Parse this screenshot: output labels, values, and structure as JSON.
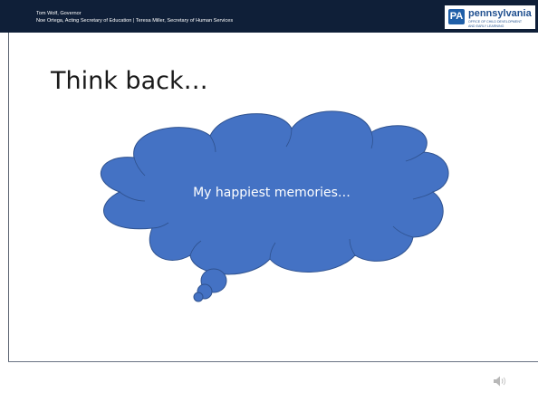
{
  "header": {
    "governor_line": "Tom Wolf, Governor",
    "secretaries_line": "Noe Ortega, Acting Secretary of Education | Teresa Miller, Secretary of Human Services",
    "logo": {
      "badge_text": "PA",
      "brand_name": "pennsylvania",
      "office_line_1": "OFFICE OF CHILD DEVELOPMENT",
      "office_line_2": "AND EARLY LEARNING"
    }
  },
  "slide": {
    "title": "Think back…",
    "thought_cloud_text": "My happiest memories…"
  },
  "icons": {
    "audio": "speaker-icon"
  },
  "colors": {
    "header_bg": "#0f1f38",
    "cloud_fill": "#4472c4",
    "cloud_stroke": "#2f528f",
    "brand_blue": "#1f4f8f"
  }
}
